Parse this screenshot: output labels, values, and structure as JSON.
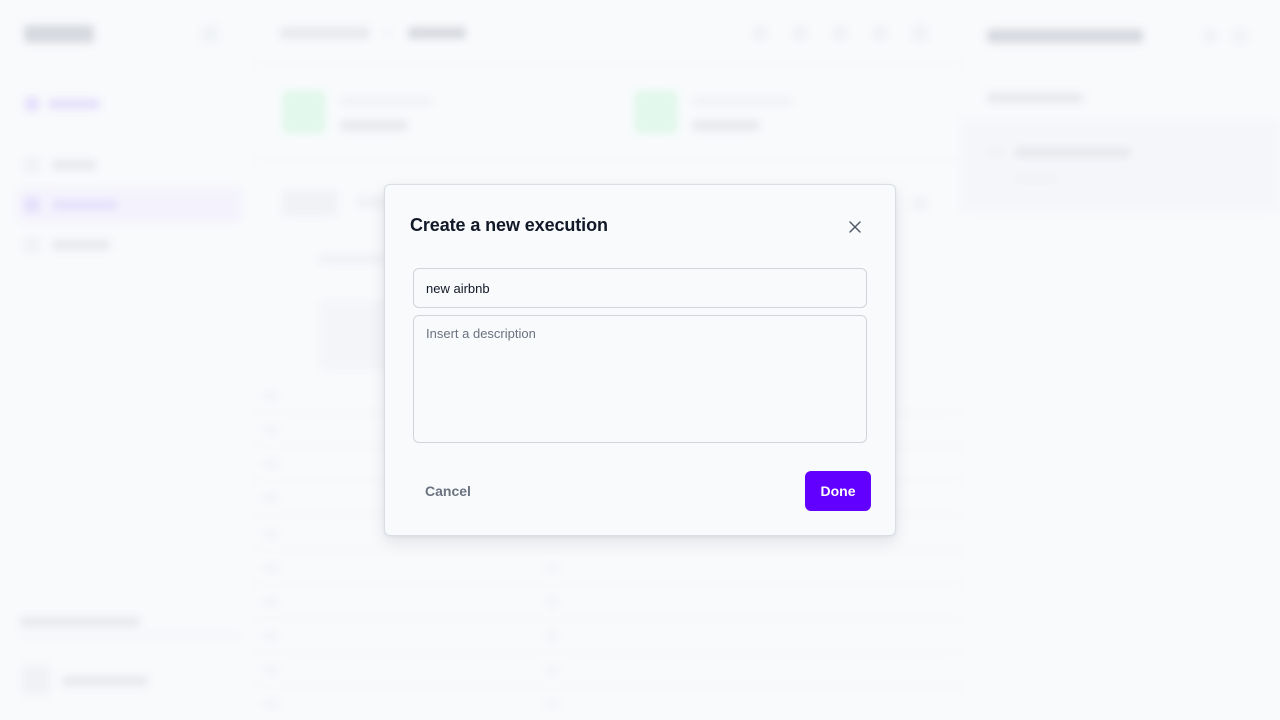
{
  "modal": {
    "title": "Create a new execution",
    "close_icon": "close-icon",
    "name_field": {
      "value": "new airbnb",
      "placeholder": ""
    },
    "description_field": {
      "value": "",
      "placeholder": "Insert a description"
    },
    "cancel_label": "Cancel",
    "done_label": "Done"
  },
  "colors": {
    "primary": "#6200ff",
    "title_text": "#111827",
    "muted_text": "#6b7280",
    "border": "#d1d5db",
    "background": "#f8fafc"
  },
  "background_app": {
    "state": "blurred-behind-modal",
    "sidebar_icons": [
      "logo",
      "collapse-icon",
      "workspace-icon",
      "flows-icon",
      "executions-icon",
      "datasets-icon",
      "user-avatar"
    ],
    "header_action_icons": [
      "action-icon",
      "action-icon",
      "action-icon",
      "action-icon",
      "action-icon"
    ],
    "status_cards": 2,
    "right_panel_icons": [
      "refresh-icon",
      "close-icon"
    ]
  }
}
